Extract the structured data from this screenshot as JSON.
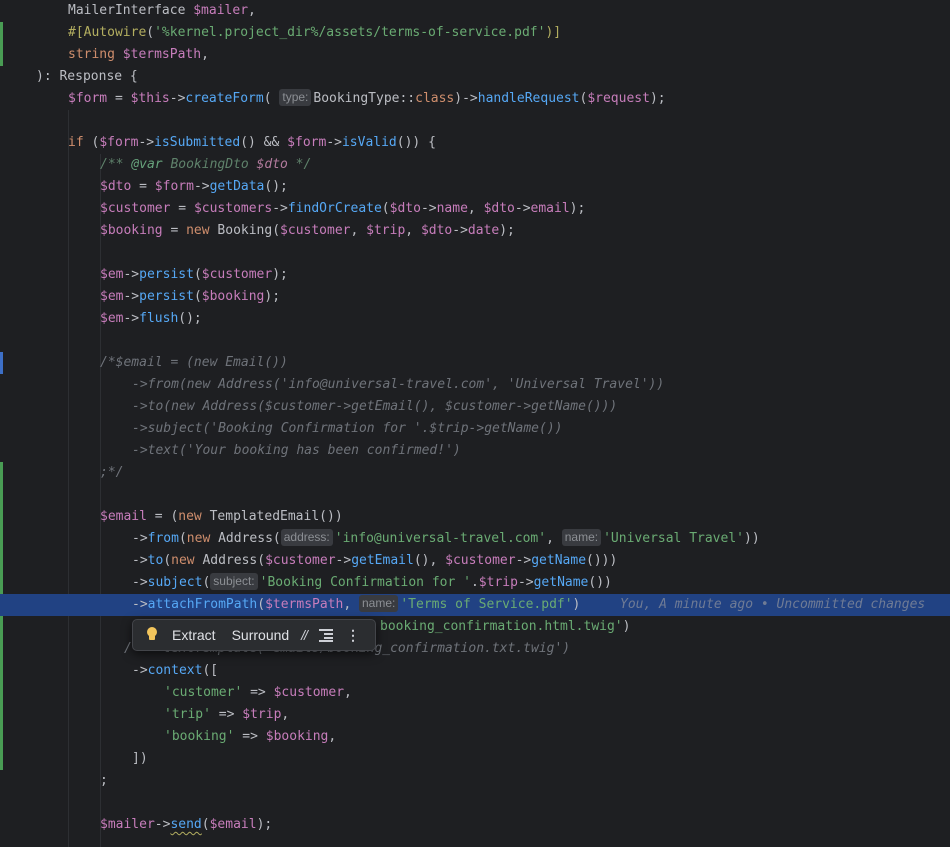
{
  "code": {
    "l1": {
      "type": "MailerInterface",
      "var": "$mailer",
      "comma": ","
    },
    "l2": {
      "attr_open": "#[",
      "attr_name": "Autowire",
      "paren_open": "(",
      "value": "'%kernel.project_dir%/assets/terms-of-service.pdf'",
      "close": ")]"
    },
    "l3": {
      "kw": "string",
      "var": "$termsPath",
      "comma": ","
    },
    "l4": {
      "text": "): Response {"
    },
    "l5": {
      "var_form": "$form",
      "eq": " = ",
      "this": "$this",
      "arrow": "->",
      "method": "createForm",
      "open": "(",
      "hint": "type:",
      "arg": "BookingType::",
      "class_kw": "class",
      "close": ")->",
      "method2": "handleRequest",
      "open2": "(",
      "var_req": "$request",
      "end": ");"
    },
    "l7": {
      "kw_if": "if",
      "open": " (",
      "var1": "$form",
      "arrow1": "->",
      "m1": "isSubmitted",
      "mid": "() && ",
      "var2": "$form",
      "arrow2": "->",
      "m2": "isValid",
      "end": "()) {"
    },
    "l8": {
      "open": "/** ",
      "tag": "@var",
      "type": " BookingDto ",
      "var": "$dto",
      "close": " */"
    },
    "l9": {
      "var": "$dto",
      "eq": " = ",
      "var2": "$form",
      "arrow": "->",
      "m": "getData",
      "end": "();"
    },
    "l10": {
      "var": "$customer",
      "eq": " = ",
      "var2": "$customers",
      "arrow": "->",
      "m": "findOrCreate",
      "open": "(",
      "a1": "$dto",
      "ar1": "->",
      "p1": "name",
      "sep": ", ",
      "a2": "$dto",
      "ar2": "->",
      "p2": "email",
      "end": ");"
    },
    "l11": {
      "var": "$booking",
      "eq": " = ",
      "kw_new": "new",
      "cls": " Booking(",
      "a1": "$customer",
      "s1": ", ",
      "a2": "$trip",
      "s2": ", ",
      "a3": "$dto",
      "ar": "->",
      "p": "date",
      "end": ");"
    },
    "l13": {
      "var": "$em",
      "arrow": "->",
      "m": "persist",
      "open": "(",
      "arg": "$customer",
      "end": ");"
    },
    "l14": {
      "var": "$em",
      "arrow": "->",
      "m": "persist",
      "open": "(",
      "arg": "$booking",
      "end": ");"
    },
    "l15": {
      "var": "$em",
      "arrow": "->",
      "m": "flush",
      "end": "();"
    },
    "l17": {
      "text": "/*$email = (new Email())"
    },
    "l18": {
      "text": "->from(new Address('info@universal-travel.com', 'Universal Travel'))"
    },
    "l19": {
      "text": "->to(new Address($customer->getEmail(), $customer->getName()))"
    },
    "l20": {
      "text": "->subject('Booking Confirmation for '.$trip->getName())"
    },
    "l21": {
      "text": "->text('Your booking has been confirmed!')"
    },
    "l22": {
      "text": ";*/"
    },
    "l24": {
      "var": "$email",
      "eq": " = (",
      "kw_new": "new",
      "cls": " TemplatedEmail())"
    },
    "l25": {
      "arrow": "->",
      "m": "from",
      "open": "(",
      "kw_new": "new",
      "cls": " Address(",
      "hint1": "address:",
      "s1": "'info@universal-travel.com'",
      "sep": ", ",
      "hint2": "name:",
      "s2": "'Universal Travel'",
      "end": "))"
    },
    "l26": {
      "arrow": "->",
      "m": "to",
      "open": "(",
      "kw_new": "new",
      "cls": " Address(",
      "v1": "$customer",
      "ar1": "->",
      "m1": "getEmail",
      "mid": "(), ",
      "v2": "$customer",
      "ar2": "->",
      "m2": "getName",
      "end": "()))"
    },
    "l27": {
      "arrow": "->",
      "m": "subject",
      "open": "(",
      "hint": "subject:",
      "s": "'Booking Confirmation for '",
      "dot": ".",
      "v": "$trip",
      "ar": "->",
      "m2": "getName",
      "end": "())"
    },
    "l28": {
      "arrow": "->",
      "m": "attachFromPath",
      "open": "(",
      "v": "$termsPath",
      "sep": ", ",
      "hint": "name:",
      "s": "'Terms of Service.pdf'",
      "end": ")",
      "blame": "You, A minute ago • Uncommitted changes"
    },
    "l29": {
      "s_tail": "booking_confirmation.html.twig'",
      "end": ")"
    },
    "l30": {
      "open": "/",
      "rest": "  ->textTemplate('emails/booking_confirmation.txt.twig')"
    },
    "l31": {
      "arrow": "->",
      "m": "context",
      "end": "(["
    },
    "l32": {
      "s": "'customer'",
      "op": " => ",
      "v": "$customer",
      "end": ","
    },
    "l33": {
      "s": "'trip'",
      "op": " => ",
      "v": "$trip",
      "end": ","
    },
    "l34": {
      "s": "'booking'",
      "op": " => ",
      "v": "$booking",
      "end": ","
    },
    "l35": {
      "text": "])"
    },
    "l36": {
      "text": ";"
    },
    "l38": {
      "var": "$mailer",
      "arrow": "->",
      "m": "send",
      "open": "(",
      "arg": "$email",
      "end": ");"
    }
  },
  "popup": {
    "extract_label": "Extract",
    "surround_label": "Surround",
    "comment_icon": "comment-icon",
    "format_icon": "reformat-icon",
    "more_icon": "more-vertical-icon",
    "bulb_icon": "lightbulb-icon"
  },
  "colors": {
    "background": "#1e1f22",
    "highlight": "#214283",
    "variable": "#c77dbb",
    "method": "#56a8f5",
    "string": "#6aab73",
    "keyword": "#cf8e6d",
    "vcs_added": "#499c54",
    "vcs_modified": "#3d6fc7"
  }
}
